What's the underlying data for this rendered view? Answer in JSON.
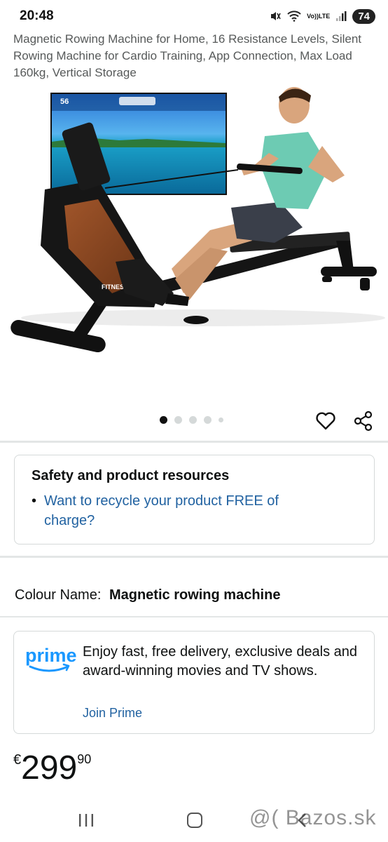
{
  "status_bar": {
    "time": "20:48",
    "volte_line1": "Vo))",
    "volte_line2": "LTE",
    "battery": "74",
    "icons": [
      "mute-icon",
      "wifi-icon",
      "volte-icon",
      "signal-icon",
      "battery-icon"
    ]
  },
  "product": {
    "title": "Magnetic Rowing Machine for Home, 16 Resistance Levels, Silent Rowing Machine for Cardio Training, App Connection, Max Load 160kg, Vertical Storage",
    "image_text": {
      "brand": "FITNESS",
      "display_number": "56"
    },
    "image_count": 5,
    "active_image": 1
  },
  "safety": {
    "title": "Safety and product resources",
    "link": "Want to recycle your product FREE of charge?"
  },
  "colour": {
    "label": "Colour Name:",
    "value": "Magnetic rowing machine"
  },
  "prime": {
    "logo_text": "prime",
    "text": "Enjoy fast, free delivery, exclusive deals and award-winning movies and TV shows.",
    "link": "Join Prime",
    "accent": "#1a98ff"
  },
  "price": {
    "symbol": "€",
    "whole": "299",
    "fraction": "90"
  },
  "watermark": "@( Bazos.sk",
  "colors": {
    "link": "#2162a1",
    "text": "#0f1111",
    "secondary_text": "#565959",
    "border": "#d5d9d9"
  }
}
